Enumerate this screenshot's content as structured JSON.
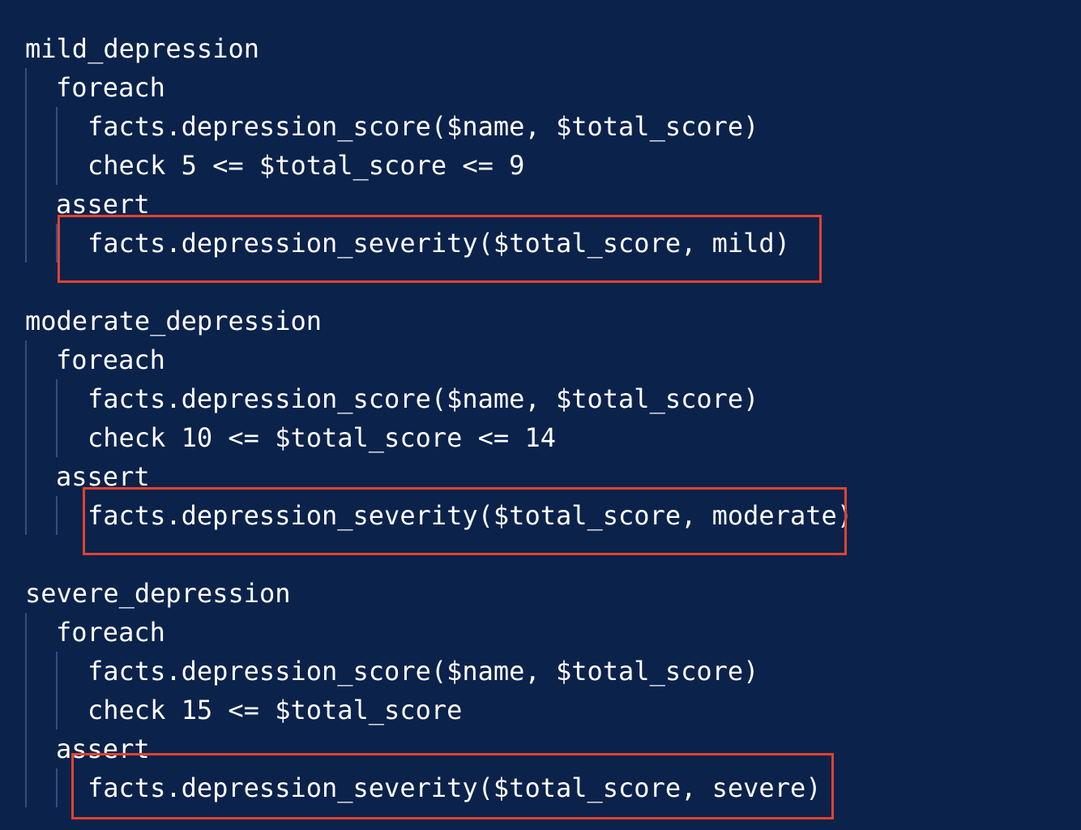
{
  "editor": {
    "background": "#0b224b",
    "text_color": "#ffffff",
    "highlight_color": "#e0432f",
    "rules": [
      {
        "name": "mild_depression",
        "foreach": "foreach",
        "fact": "facts.depression_score($name, $total_score)",
        "check": "check 5 <= $total_score <= 9",
        "assert": "assert",
        "assertion": "facts.depression_severity($total_score, mild)"
      },
      {
        "name": "moderate_depression",
        "foreach": "foreach",
        "fact": "facts.depression_score($name, $total_score)",
        "check": "check 10 <= $total_score <= 14",
        "assert": "assert",
        "assertion": "facts.depression_severity($total_score, moderate)"
      },
      {
        "name": "severe_depression",
        "foreach": "foreach",
        "fact": "facts.depression_score($name, $total_score)",
        "check": "check 15 <= $total_score",
        "assert": "assert",
        "assertion": "facts.depression_severity($total_score, severe)"
      }
    ]
  }
}
